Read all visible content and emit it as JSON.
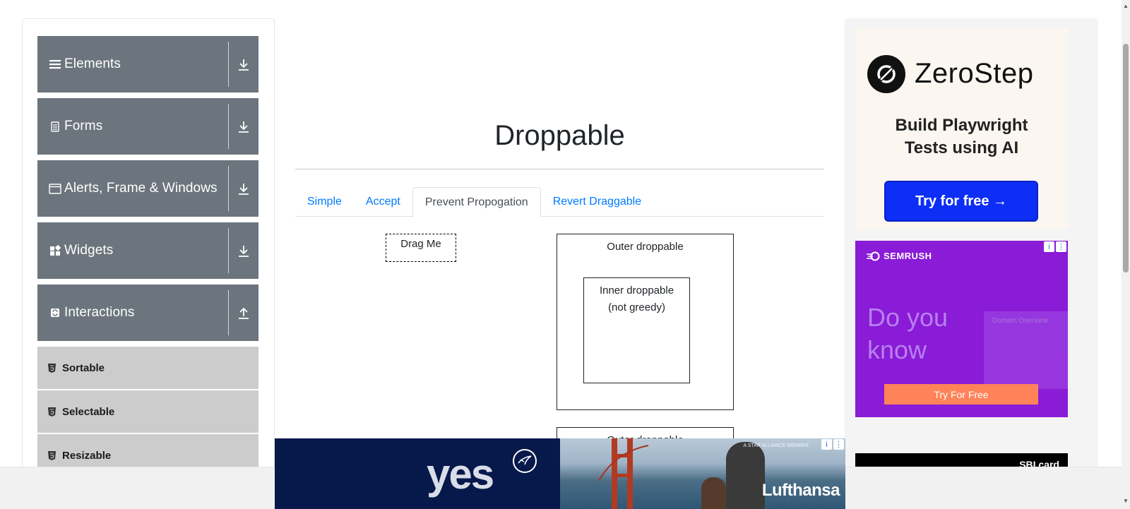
{
  "sidebar": {
    "groups": [
      {
        "label": "Elements",
        "icon": "hamburger-icon",
        "arrow": "download-icon"
      },
      {
        "label": "Forms",
        "icon": "form-doc-icon",
        "arrow": "download-icon"
      },
      {
        "label": "Alerts, Frame & Windows",
        "icon": "window-icon",
        "arrow": "download-icon"
      },
      {
        "label": "Widgets",
        "icon": "widgets-grid-icon",
        "arrow": "download-icon"
      },
      {
        "label": "Interactions",
        "icon": "interactions-icon",
        "arrow": "upload-icon"
      }
    ],
    "items": [
      {
        "label": "Sortable"
      },
      {
        "label": "Selectable"
      },
      {
        "label": "Resizable"
      }
    ]
  },
  "main": {
    "title": "Droppable",
    "tabs": [
      {
        "label": "Simple",
        "active": false
      },
      {
        "label": "Accept",
        "active": false
      },
      {
        "label": "Prevent Propogation",
        "active": true
      },
      {
        "label": "Revert Draggable",
        "active": false
      }
    ],
    "drag_label": "Drag Me",
    "outer_label": "Outer droppable",
    "inner_label_line1": "Inner droppable",
    "inner_label_line2": "(not greedy)",
    "outer2_label": "Outer droppable"
  },
  "ads": {
    "zerostep": {
      "brand": "ZeroStep",
      "tagline_line1": "Build Playwright",
      "tagline_line2": "Tests using AI",
      "button": "Try for free →"
    },
    "semrush": {
      "brand": "SEMRUSH",
      "headline_line1": "Do you",
      "headline_line2": "know",
      "panel_title": "Domain Overview",
      "button": "Try For Free"
    },
    "sbi": {
      "brand": "SBI card"
    },
    "lufthansa": {
      "left_text": "yes",
      "brand": "Lufthansa",
      "alliance": "A STAR ALLIANCE MEMBER"
    }
  },
  "colors": {
    "sidebar_group_bg": "#6c757d",
    "sidebar_item_bg": "#cccccc",
    "link_blue": "#007bff",
    "zerostep_button": "#0d2ef5",
    "semrush_bg": "#8a1bd6",
    "semrush_button": "#ff8259",
    "lufthansa_navy": "#07184b"
  }
}
